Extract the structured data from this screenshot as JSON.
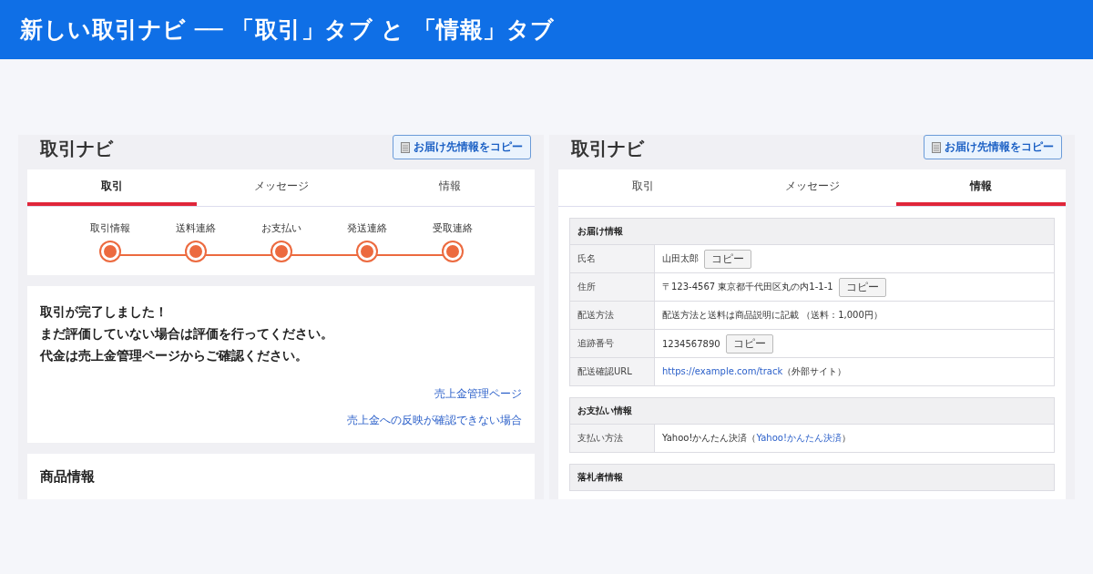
{
  "banner": {
    "title": "新しい取引ナビ ── 「取引」タブ と 「情報」タブ"
  },
  "panels": [
    {
      "kind": "progress",
      "title": "取引ナビ",
      "copy_button": "お届け先情報をコピー",
      "tabs": [
        {
          "label": "取引",
          "selected": true
        },
        {
          "label": "メッセージ",
          "selected": false
        },
        {
          "label": "情報",
          "selected": false
        }
      ],
      "steps": [
        "取引情報",
        "送料連絡",
        "お支払い",
        "発送連絡",
        "受取連絡"
      ],
      "message": [
        "取引が完了しました！",
        "まだ評価していない場合は評価を行ってください。",
        "代金は売上金管理ページからご確認ください。"
      ],
      "links": [
        "売上金管理ページ",
        "売上金への反映が確認できない場合"
      ],
      "section_title": "商品情報"
    },
    {
      "kind": "info",
      "title": "取引ナビ",
      "copy_button": "お届け先情報をコピー",
      "tabs": [
        {
          "label": "取引",
          "selected": false
        },
        {
          "label": "メッセージ",
          "selected": false
        },
        {
          "label": "情報",
          "selected": true
        }
      ],
      "sections": [
        {
          "title": "お届け情報",
          "rows": [
            {
              "label": "氏名",
              "parts": [
                {
                  "kind": "text",
                  "text": "山田太郎"
                }
              ],
              "copy": "コピー"
            },
            {
              "label": "住所",
              "parts": [
                {
                  "kind": "text",
                  "text": "〒123-4567 東京都千代田区丸の内1-1-1"
                }
              ],
              "copy": "コピー"
            },
            {
              "label": "配送方法",
              "parts": [
                {
                  "kind": "text",
                  "text": "配送方法と送料は商品説明に記載 （送料：1,000円）"
                }
              ]
            },
            {
              "label": "追跡番号",
              "parts": [
                {
                  "kind": "text",
                  "text": "1234567890"
                }
              ],
              "copy": "コピー"
            },
            {
              "label": "配送確認URL",
              "parts": [
                {
                  "kind": "link",
                  "text": "https://example.com/track"
                },
                {
                  "kind": "text",
                  "text": "（外部サイト）"
                }
              ]
            }
          ]
        },
        {
          "title": "お支払い情報",
          "rows": [
            {
              "label": "支払い方法",
              "parts": [
                {
                  "kind": "text",
                  "text": "Yahoo!かんたん決済（"
                },
                {
                  "kind": "link",
                  "text": "Yahoo!かんたん決済"
                },
                {
                  "kind": "text",
                  "text": "）"
                }
              ]
            }
          ]
        },
        {
          "title": "落札者情報"
        }
      ]
    }
  ]
}
